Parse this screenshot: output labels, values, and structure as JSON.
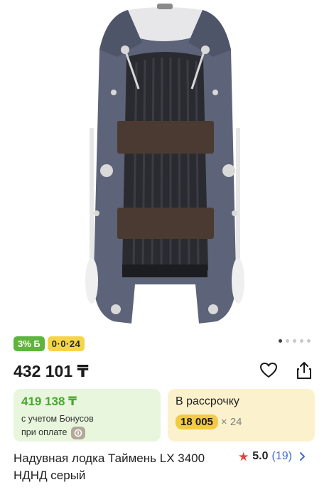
{
  "product": {
    "image_alt": "inflatable-boat-photo",
    "gallery_dots": [
      true,
      false,
      false,
      false,
      false
    ],
    "badges": {
      "bonus": "3% Б",
      "installment": "0·0·24"
    },
    "price": "432 101 ₸",
    "bonus_card": {
      "price": "419 138 ₸",
      "line1": "с учетом Бонусов",
      "line2": "при оплате"
    },
    "installment_card": {
      "title": "В рассрочку",
      "amount": "18 005",
      "multiplier": "× 24"
    },
    "title": "Надувная лодка Таймень LX 3400 НДНД серый",
    "rating": {
      "value": "5.0",
      "count": "(19)"
    }
  },
  "colors": {
    "bonus_green": "#5fb43c",
    "installment_yellow": "#f5d548",
    "star_red": "#e0433b",
    "link_blue": "#3e6fd0"
  },
  "icons": [
    "heart-icon",
    "share-icon",
    "star-icon",
    "chevron-right-icon",
    "bonus-coin-icon"
  ]
}
